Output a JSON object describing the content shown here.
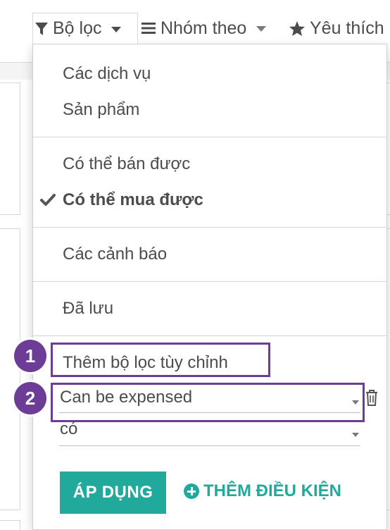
{
  "topbar": {
    "filter_label": "Bộ lọc",
    "groupby_label": "Nhóm theo",
    "favorites_label": "Yêu thích",
    "icons": {
      "filter": "filter-icon",
      "groupby": "list-icon",
      "favorites": "star-icon"
    }
  },
  "filter_menu": {
    "group1": [
      "Các dịch vụ",
      "Sản phẩm"
    ],
    "group2": [
      {
        "label": "Có thể bán được",
        "checked": false
      },
      {
        "label": "Có thể mua được",
        "checked": true
      }
    ],
    "group3": [
      "Các cảnh báo"
    ],
    "group4": [
      "Đã lưu"
    ],
    "custom_filter": {
      "toggle_label": "Thêm bộ lọc tùy chỉnh",
      "field_value": "Can be expensed",
      "operator_value": "có",
      "apply_label": "ÁP DỤNG",
      "add_condition_label": "THÊM ĐIỀU KIỆN"
    }
  },
  "annotations": {
    "step1": "1",
    "step2": "2"
  },
  "colors": {
    "accent": "#21a99b",
    "annotation": "#6c3c97",
    "text": "#4c4c4c"
  }
}
